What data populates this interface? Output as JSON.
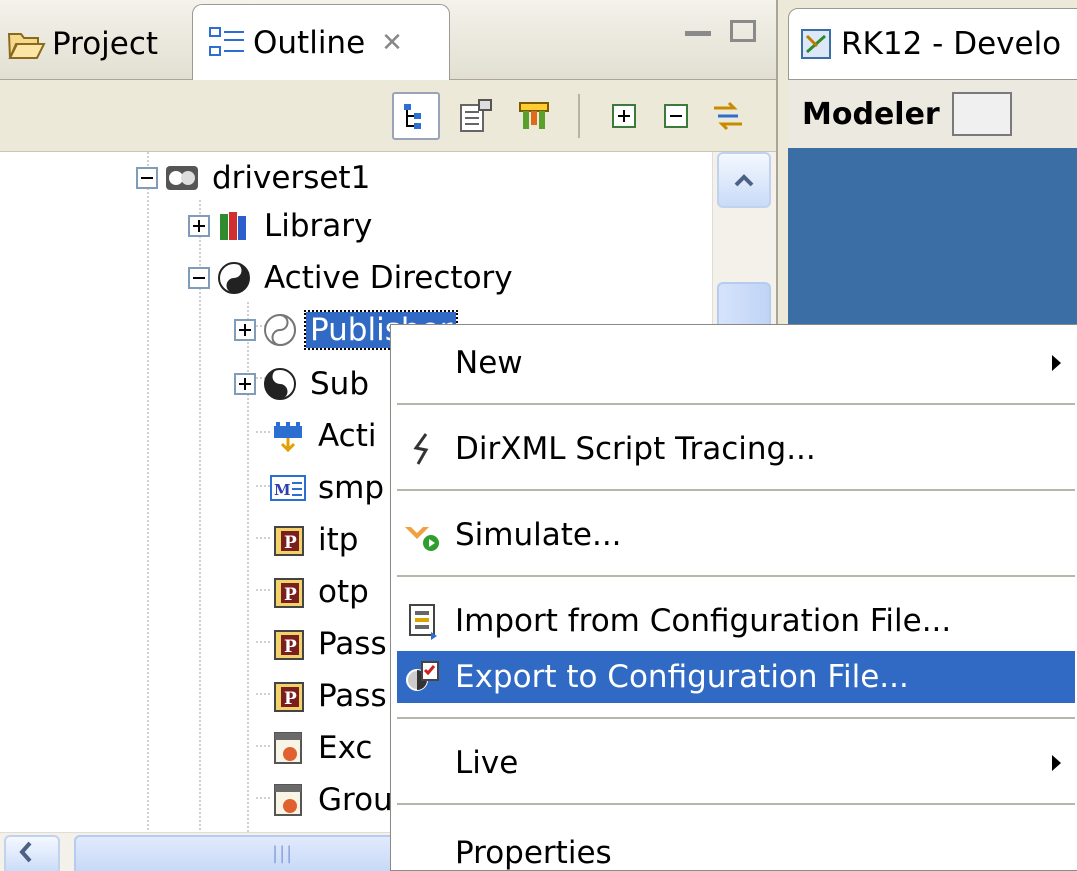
{
  "tabs": {
    "project": "Project",
    "outline": "Outline",
    "outline_close": "✕"
  },
  "tree": {
    "items": [
      {
        "label": "driverset1"
      },
      {
        "label": "Library"
      },
      {
        "label": "Active Directory"
      },
      {
        "label": "Publisher"
      },
      {
        "label": "Sub"
      },
      {
        "label": "Acti"
      },
      {
        "label": "smp"
      },
      {
        "label": "itp"
      },
      {
        "label": "otp"
      },
      {
        "label": "Pass"
      },
      {
        "label": "Pass"
      },
      {
        "label": "Exc"
      },
      {
        "label": "Grou"
      }
    ]
  },
  "editor": {
    "tab_title": "RK12 - Develo",
    "toolbar_label": "Modeler"
  },
  "context_menu": {
    "items": [
      {
        "label": "New",
        "submenu": true
      },
      {
        "label": "DirXML Script Tracing..."
      },
      {
        "label": "Simulate..."
      },
      {
        "label": "Import from Configuration File..."
      },
      {
        "label": "Export to Configuration File...",
        "highlighted": true
      },
      {
        "label": "Live",
        "submenu": true
      },
      {
        "label": "Properties"
      }
    ]
  },
  "colors": {
    "selection": "#316ac5",
    "canvas": "#3a6ea5",
    "chrome": "#ece9d8"
  },
  "scroll_h_grip": "|||"
}
